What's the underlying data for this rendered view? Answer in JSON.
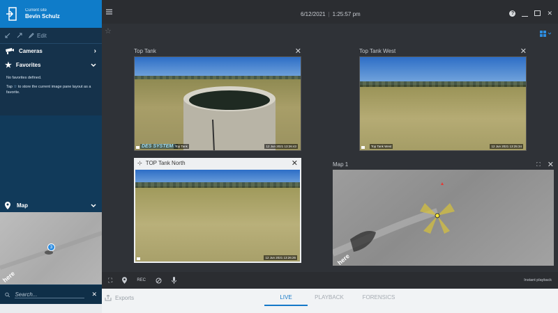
{
  "sidebar": {
    "site_caption": "Current site",
    "site_name": "Bevin Schulz",
    "edit_label": "Edit",
    "cameras_label": "Cameras",
    "favorites_label": "Favorites",
    "favorites_empty": "No favorites defined.",
    "favorites_tap": "Tap",
    "favorites_hint": "to store the current image pane layout as a favorite.",
    "map_label": "Map",
    "map_marker_count": "3",
    "map_brand": "here",
    "search_placeholder": "Search..."
  },
  "topbar": {
    "date": "6/12/2021",
    "time": "1:25:57 pm"
  },
  "tiles": {
    "top_tank": {
      "title": "Top Tank",
      "timestamp": "12 Jun 2021  13:26:43",
      "label": "Top Tank",
      "logo_text": "DES SYSTEMS"
    },
    "top_tank_west": {
      "title": "Top Tank West",
      "timestamp": "12 Jun 2021  13:25:34",
      "label": "Top Tank West"
    },
    "top_tank_north": {
      "title": "TOP Tank North",
      "timestamp": "12 Jun 2021  13:26:26"
    },
    "map1": {
      "title": "Map 1",
      "brand": "here"
    }
  },
  "bottombar": {
    "rec_label": "REC",
    "instant_playback": "Instant playback"
  },
  "footer": {
    "exports_label": "Exports",
    "tabs": [
      "LIVE",
      "PLAYBACK",
      "FORENSICS"
    ]
  },
  "colors": {
    "accent": "#1478c8",
    "sidebar_bg": "#113a5a",
    "site_header": "#0f7cc9",
    "main_bg": "#2f3237"
  }
}
